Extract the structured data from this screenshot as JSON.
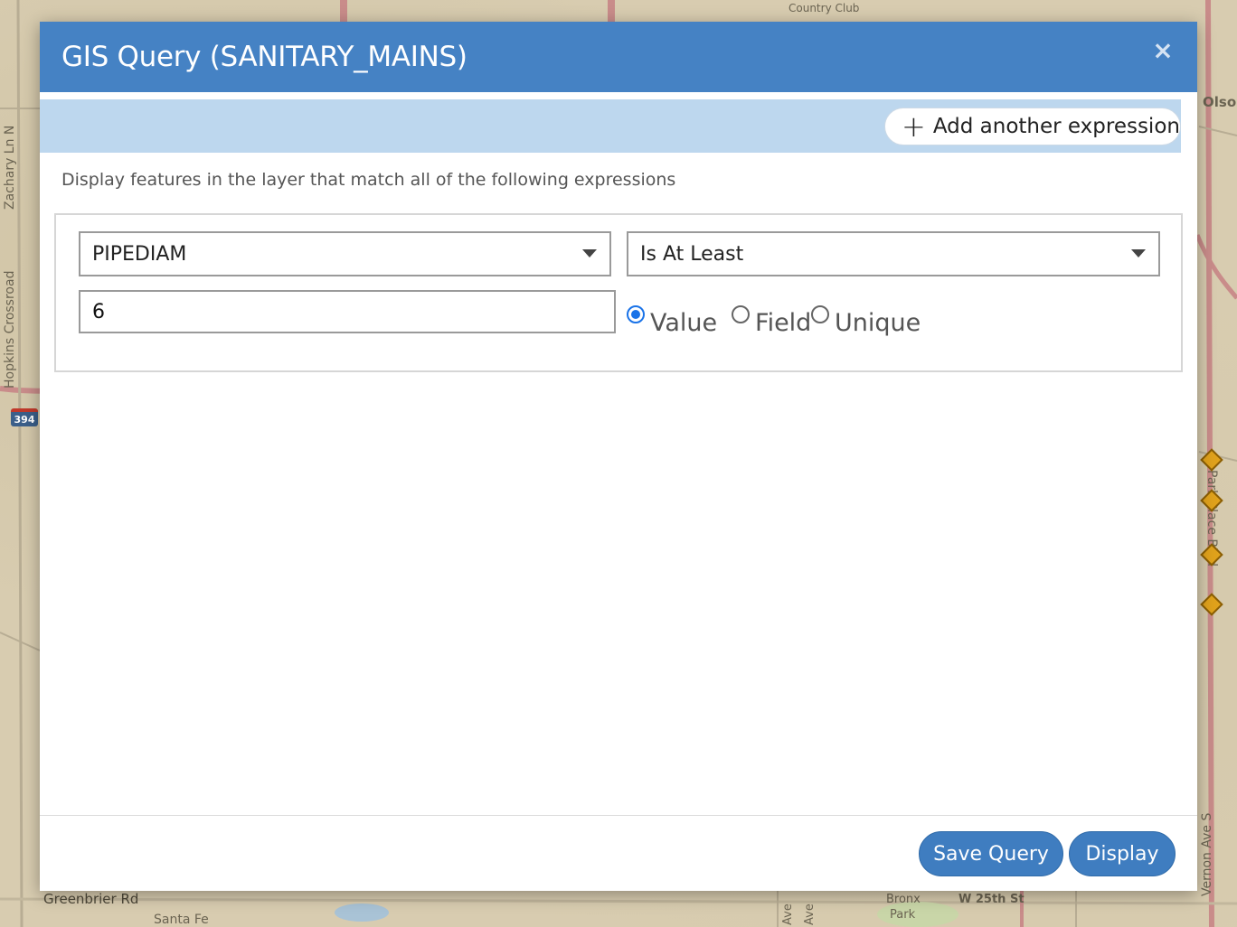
{
  "map": {
    "labels": {
      "zachary": "Zachary Ln N",
      "hopkins": "Hopkins Crossroad",
      "greenbrier": "Greenbrier Rd",
      "santa_fe": "Santa Fe",
      "olson": "Olso",
      "vernon": "Vernon Ave S",
      "parkplace": "Park Place Blvd",
      "bronx": "Bronx",
      "park": "Park",
      "w25th": "W 25th St",
      "ave1": "Ave",
      "ave2": "Ave",
      "country_club": "Country Club"
    },
    "shield": "394"
  },
  "dialog": {
    "title": "GIS Query (SANITARY_MAINS)",
    "close_icon": "×",
    "toolbar": {
      "add_icon": "+",
      "add_label": "Add another expression"
    },
    "instructions": "Display features in the layer that match all of the following expressions",
    "expression": {
      "field": "PIPEDIAM",
      "operator": "Is At Least",
      "value": "6",
      "value_type_options": [
        {
          "label": "Value",
          "checked": true
        },
        {
          "label": "Field",
          "checked": false
        },
        {
          "label": "Unique",
          "checked": false
        }
      ]
    },
    "footer": {
      "save_label": "Save Query",
      "display_label": "Display"
    }
  }
}
